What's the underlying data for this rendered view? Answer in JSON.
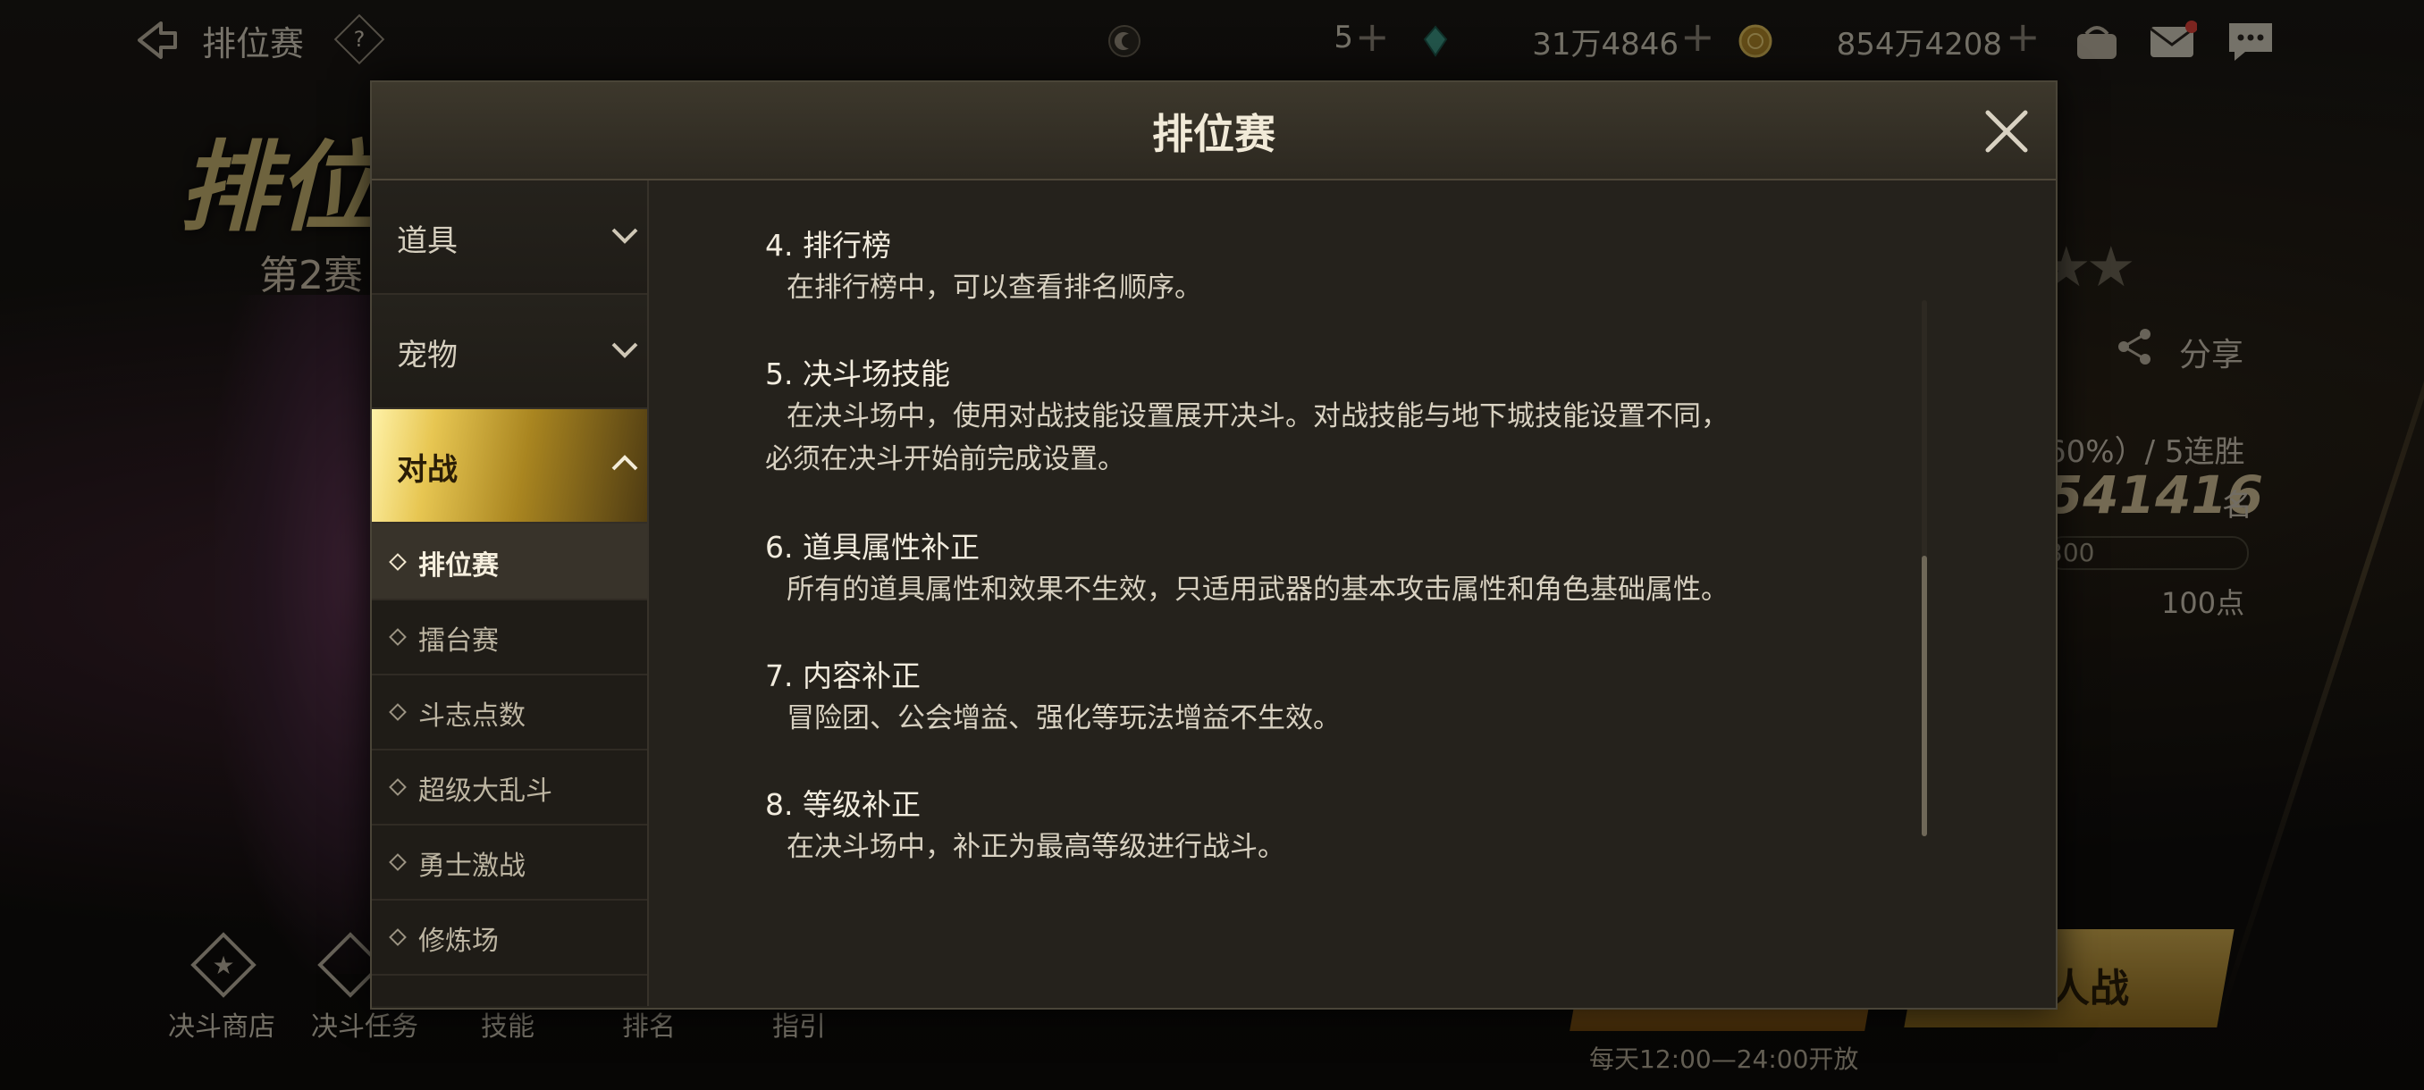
{
  "topbar": {
    "title": "排位赛",
    "help": "?",
    "resources": [
      {
        "icon": "crescent-coin-icon",
        "value": "5"
      },
      {
        "icon": "green-crystal-icon",
        "value": "31万4846"
      },
      {
        "icon": "gold-coin-icon",
        "value": "854万4208"
      }
    ],
    "plus": "+"
  },
  "background": {
    "title_art": "排位",
    "season": "第2赛",
    "share_label": "分享",
    "streak": "60%）/ 5连胜",
    "score": "541416",
    "rank_unit": "名",
    "bar_text": "300",
    "points": "100点",
    "big_button": "人战",
    "open_time": "每天12:00—24:00开放",
    "bottom_nav": [
      "决斗商店",
      "决斗任务",
      "技能",
      "排名",
      "指引"
    ]
  },
  "dialog": {
    "title": "排位赛",
    "sidebar": {
      "categories": [
        {
          "label": "道具"
        },
        {
          "label": "宠物"
        },
        {
          "label": "对战"
        }
      ],
      "subitems": [
        {
          "label": "排位赛"
        },
        {
          "label": "擂台赛"
        },
        {
          "label": "斗志点数"
        },
        {
          "label": "超级大乱斗"
        },
        {
          "label": "勇士激战"
        },
        {
          "label": "修炼场"
        }
      ]
    },
    "sections": [
      {
        "heading": "4. 排行榜",
        "body": [
          "在排行榜中，可以查看排名顺序。"
        ]
      },
      {
        "heading": "5. 决斗场技能",
        "body": [
          "在决斗场中，使用对战技能设置展开决斗。对战技能与地下城技能设置不同，",
          "必须在决斗开始前完成设置。"
        ]
      },
      {
        "heading": "6. 道具属性补正",
        "body": [
          "所有的道具属性和效果不生效，只适用武器的基本攻击属性和角色基础属性。"
        ]
      },
      {
        "heading": "7. 内容补正",
        "body": [
          "冒险团、公会增益、强化等玩法增益不生效。"
        ]
      },
      {
        "heading": "8. 等级补正",
        "body": [
          "在决斗场中，补正为最高等级进行战斗。"
        ]
      }
    ]
  },
  "colors": {
    "accent_gold": "#e7c652",
    "panel_bg": "#25221c",
    "text_primary": "#f2ecde"
  }
}
